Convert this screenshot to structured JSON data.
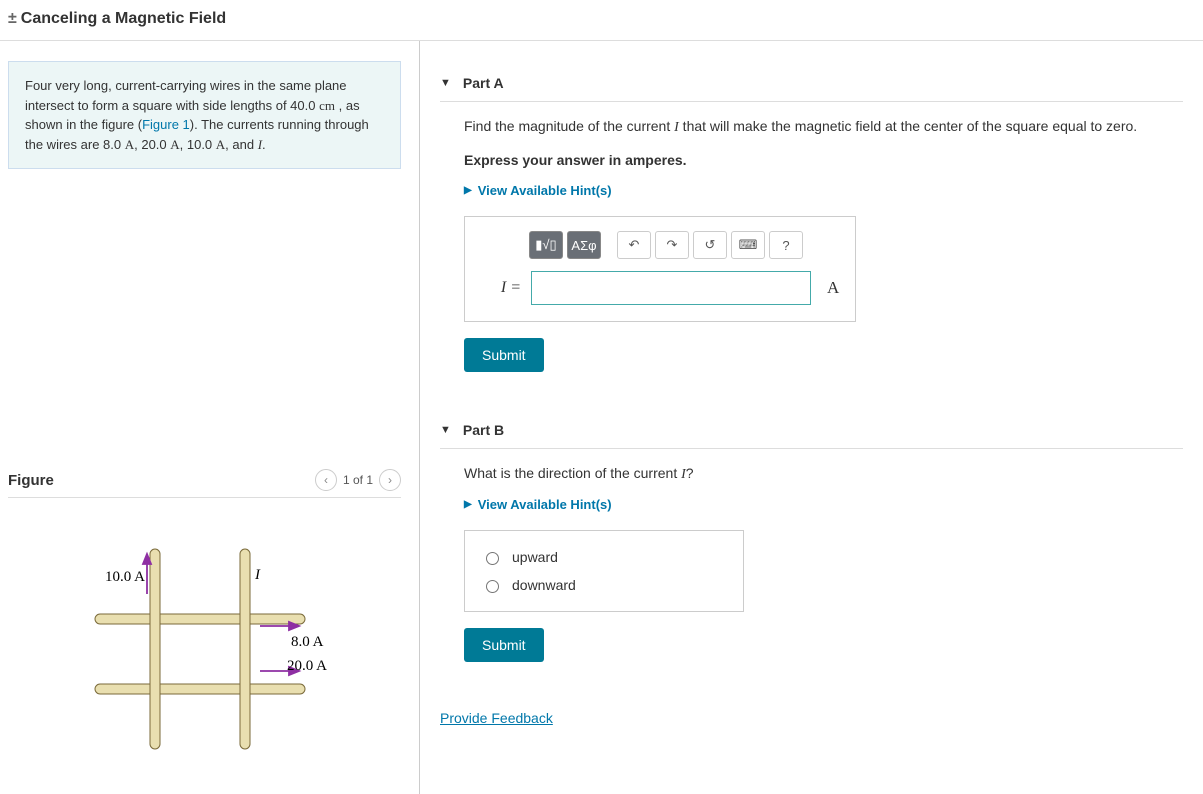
{
  "title_prefix": "±",
  "title": "Canceling a Magnetic Field",
  "info_box_html": "Four very long, current-carrying wires in the same plane intersect to form a square with side lengths of 40.0 cm , as shown in the figure (Figure 1). The currents running through the wires are 8.0 A, 20.0 A, 10.0 A, and I.",
  "figure": {
    "heading": "Figure",
    "pager": "1 of 1",
    "labels": {
      "i1": "10.0 A",
      "i2": "I",
      "i3": "8.0 A",
      "i4": "20.0 A"
    }
  },
  "partA": {
    "label": "Part A",
    "question_html": "Find the magnitude of the current I that will make the magnetic field at the center of the square equal to zero.",
    "instruction": "Express your answer in amperes.",
    "hints_label": "View Available Hint(s)",
    "eq_label": "I =",
    "unit": "A",
    "toolbar": {
      "templates": "▮√▯",
      "symbols": "ΑΣφ",
      "help": "?"
    },
    "submit": "Submit",
    "answer_value": ""
  },
  "partB": {
    "label": "Part B",
    "question_html": "What is the direction of the current I?",
    "hints_label": "View Available Hint(s)",
    "options": [
      "upward",
      "downward"
    ],
    "submit": "Submit"
  },
  "feedback": "Provide Feedback"
}
